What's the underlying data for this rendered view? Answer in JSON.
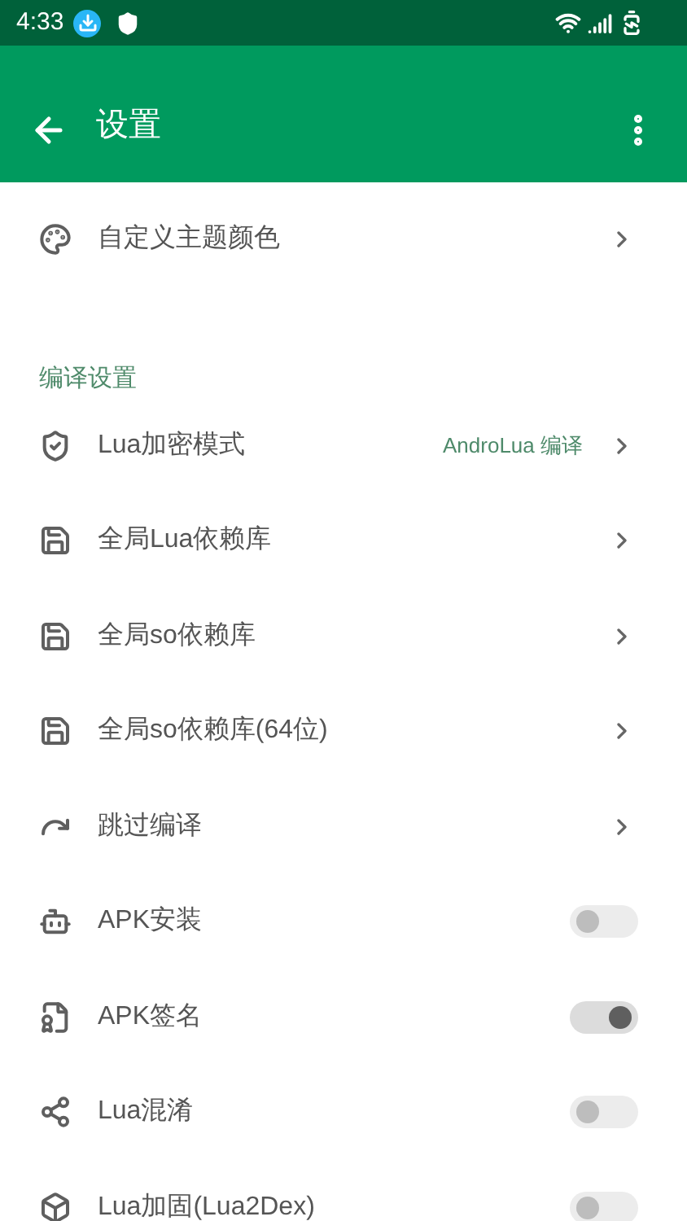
{
  "status_bar": {
    "time": "4:33"
  },
  "app_bar": {
    "title": "设置"
  },
  "top_items": [
    {
      "kind": "link",
      "label": "自定义主题颜色"
    }
  ],
  "section": {
    "title": "编译设置",
    "items": [
      {
        "kind": "link",
        "label": "Lua加密模式",
        "value": "AndroLua 编译"
      },
      {
        "kind": "link",
        "label": "全局Lua依赖库"
      },
      {
        "kind": "link",
        "label": "全局so依赖库"
      },
      {
        "kind": "link",
        "label": "全局so依赖库(64位)"
      },
      {
        "kind": "link",
        "label": "跳过编译"
      },
      {
        "kind": "switch",
        "label": "APK安装",
        "on": false
      },
      {
        "kind": "switch",
        "label": "APK签名",
        "on": true
      },
      {
        "kind": "switch",
        "label": "Lua混淆",
        "on": false
      },
      {
        "kind": "switch",
        "label": "Lua加固(Lua2Dex)",
        "on": false
      }
    ]
  }
}
